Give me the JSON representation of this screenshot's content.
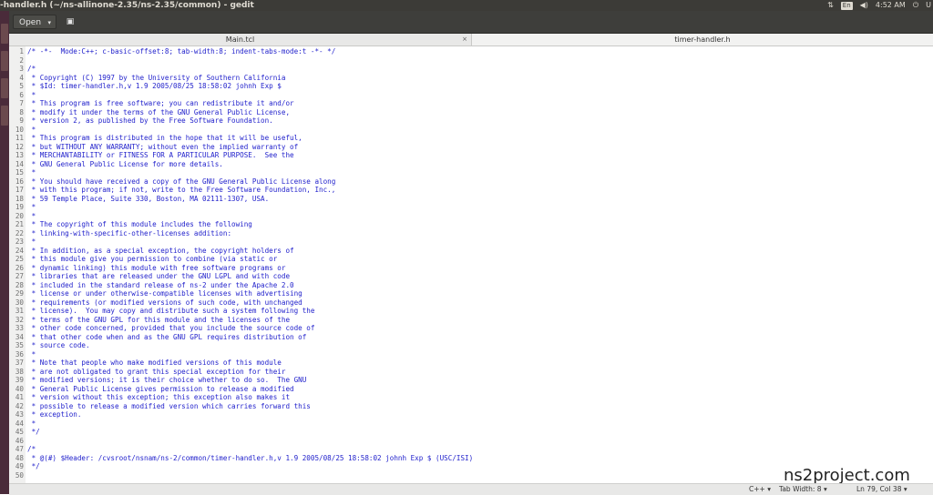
{
  "window": {
    "title": "-handler.h (~/ns-allinone-2.35/ns-2.35/common) - gedit"
  },
  "tray": {
    "keyboard": "En",
    "time": "4:52 AM",
    "user": "U"
  },
  "toolbar": {
    "open_label": "Open",
    "open_caret": "▾",
    "save_icon": "▣"
  },
  "tabs": [
    {
      "label": "Main.tcl",
      "close": "×"
    },
    {
      "label": "timer-handler.h"
    }
  ],
  "lines": [
    "/* -*-  Mode:C++; c-basic-offset:8; tab-width:8; indent-tabs-mode:t -*- */",
    "",
    "/*",
    " * Copyright (C) 1997 by the University of Southern California",
    " * $Id: timer-handler.h,v 1.9 2005/08/25 18:58:02 johnh Exp $",
    " *",
    " * This program is free software; you can redistribute it and/or",
    " * modify it under the terms of the GNU General Public License,",
    " * version 2, as published by the Free Software Foundation.",
    " *",
    " * This program is distributed in the hope that it will be useful,",
    " * but WITHOUT ANY WARRANTY; without even the implied warranty of",
    " * MERCHANTABILITY or FITNESS FOR A PARTICULAR PURPOSE.  See the",
    " * GNU General Public License for more details.",
    " *",
    " * You should have received a copy of the GNU General Public License along",
    " * with this program; if not, write to the Free Software Foundation, Inc.,",
    " * 59 Temple Place, Suite 330, Boston, MA 02111-1307, USA.",
    " *",
    " *",
    " * The copyright of this module includes the following",
    " * linking-with-specific-other-licenses addition:",
    " *",
    " * In addition, as a special exception, the copyright holders of",
    " * this module give you permission to combine (via static or",
    " * dynamic linking) this module with free software programs or",
    " * libraries that are released under the GNU LGPL and with code",
    " * included in the standard release of ns-2 under the Apache 2.0",
    " * license or under otherwise-compatible licenses with advertising",
    " * requirements (or modified versions of such code, with unchanged",
    " * license).  You may copy and distribute such a system following the",
    " * terms of the GNU GPL for this module and the licenses of the",
    " * other code concerned, provided that you include the source code of",
    " * that other code when and as the GNU GPL requires distribution of",
    " * source code.",
    " *",
    " * Note that people who make modified versions of this module",
    " * are not obligated to grant this special exception for their",
    " * modified versions; it is their choice whether to do so.  The GNU",
    " * General Public License gives permission to release a modified",
    " * version without this exception; this exception also makes it",
    " * possible to release a modified version which carries forward this",
    " * exception.",
    " *",
    " */",
    "",
    "/*",
    " * @(#) $Header: /cvsroot/nsnam/ns-2/common/timer-handler.h,v 1.9 2005/08/25 18:58:02 johnh Exp $ (USC/ISI)",
    " */",
    ""
  ],
  "status": {
    "language": "C++",
    "language_caret": "▾",
    "tab_width": "Tab Width: 8",
    "tab_caret": "▾",
    "position": "Ln 79, Col 38",
    "pos_caret": "▾"
  },
  "watermark": "ns2project.com",
  "colors": {
    "code_text": "#2222cc",
    "toolbar": "#3e3e3b",
    "topbar": "#3c3b37"
  }
}
